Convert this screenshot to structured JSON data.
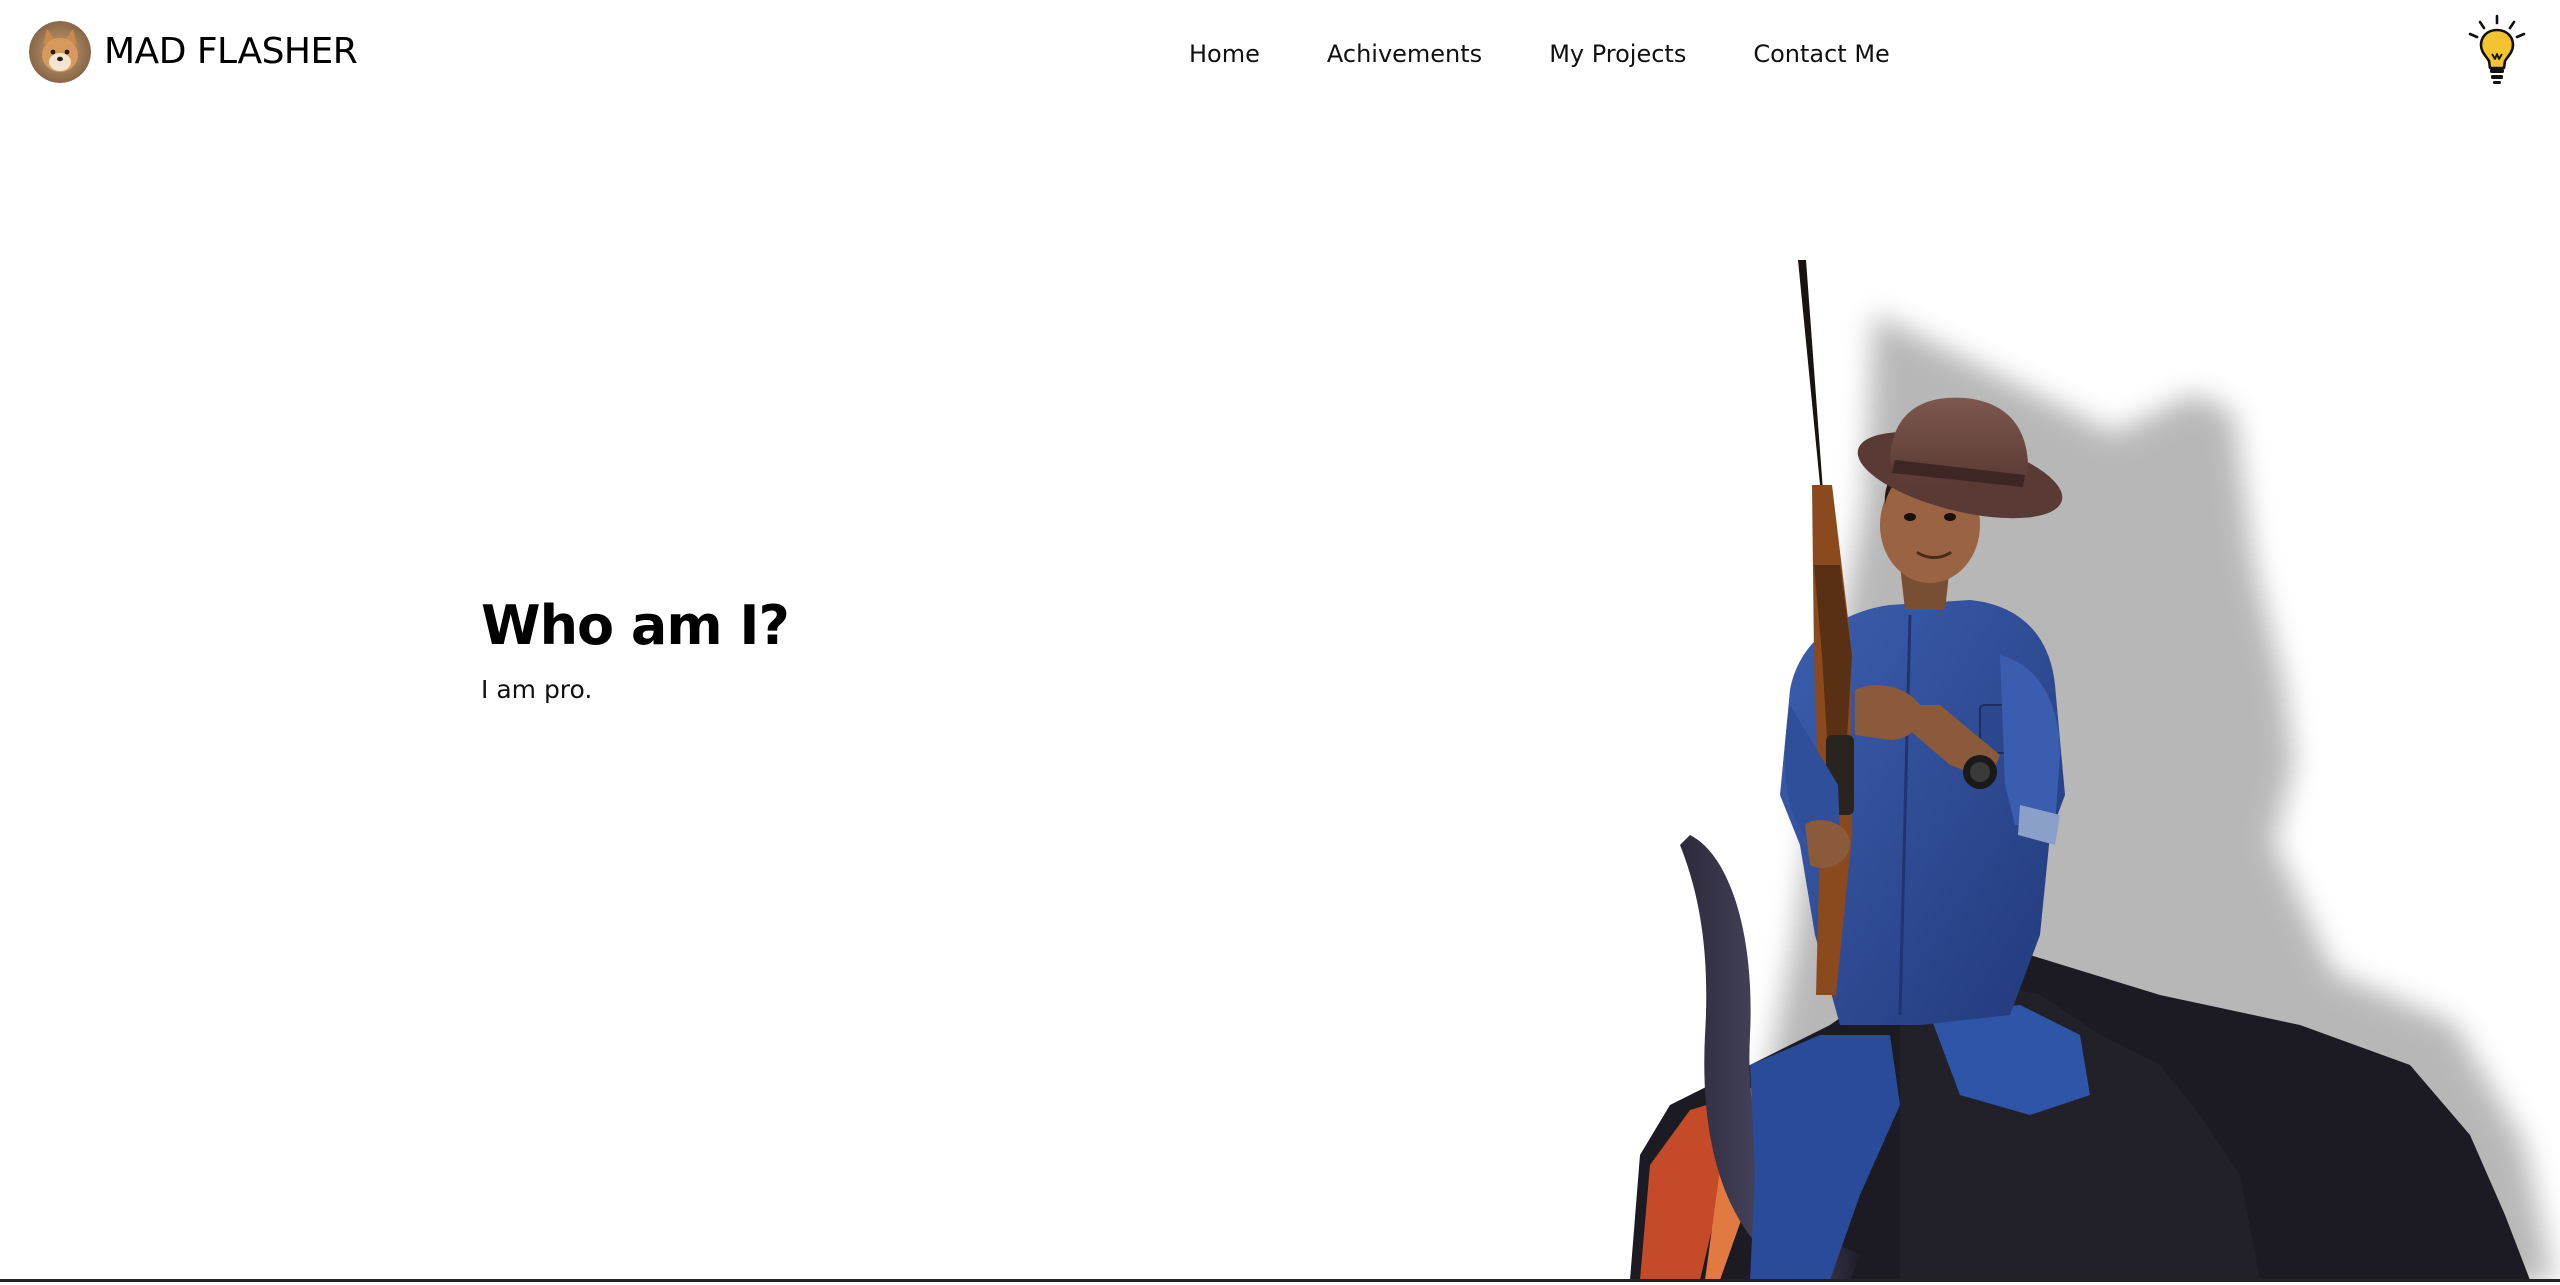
{
  "header": {
    "brand_name": "MAD FLASHER",
    "avatar_icon": "shiba-dog-avatar",
    "nav": [
      {
        "label": "Home"
      },
      {
        "label": "Achivements"
      },
      {
        "label": "My Projects"
      },
      {
        "label": "Contact Me"
      }
    ],
    "theme_toggle_icon": "lightbulb-icon"
  },
  "hero": {
    "title": "Who am I?",
    "subtitle": "I am pro.",
    "photo_icon": "boy-with-rifle-on-buffalo-photo"
  },
  "colors": {
    "background": "#ffffff",
    "text": "#000000",
    "bulb_yellow": "#f4c430",
    "shirt_blue": "#2f4f9a",
    "hat_brown": "#6e4a44",
    "buffalo_dark": "#1c1a22"
  }
}
